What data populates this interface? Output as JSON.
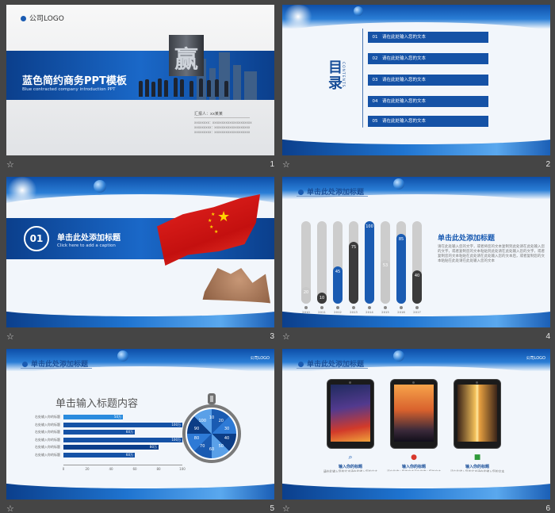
{
  "slides": [
    {
      "number": "1",
      "logo": "公司LOGO",
      "title": "蓝色简约商务PPT模板",
      "subtitle": "Blue contracted  company introduction  PPT",
      "monument_glyph": "赢",
      "presenter": "汇报人：xx某某",
      "details": [
        "xxxxxxxx：xxxxxxxxxxxxxxxxxxxxx",
        "xxxxxxxxx：xxxxxxxxxxxxxxxxxxx",
        "xxxxxxxxx：xxxxxxxxxxxxxxxxxxx"
      ]
    },
    {
      "number": "2",
      "toc_title": "目录",
      "toc_en": "CONTENTS",
      "items": [
        {
          "num": "01",
          "text": "请在此处输入您的文本"
        },
        {
          "num": "02",
          "text": "请在此处输入您的文本"
        },
        {
          "num": "03",
          "text": "请在此处输入您的文本"
        },
        {
          "num": "04",
          "text": "请在此处输入您的文本"
        },
        {
          "num": "05",
          "text": "请在此处输入您的文本"
        }
      ]
    },
    {
      "number": "3",
      "section_num": "01",
      "title": "单击此处添加标题",
      "subtitle": "Click here to add a caption"
    },
    {
      "number": "4",
      "header": "单击此处添加标题",
      "side_title": "单击此处添加标题",
      "side_body": "请在此处输入您的文字，或者将您的文本复制到此处请在此处输入您的文字，或者复制您的文本粘贴到此处请在此处输入您的文字，或者复制您的文本粘贴在此处请在此处输入您的文本后，或者复制您的文本粘贴在此处请在此处输入您的文本"
    },
    {
      "number": "5",
      "header": "单击此处添加标题",
      "heading": "单击输入标题内容",
      "corner_logo": "公司LOGO"
    },
    {
      "number": "6",
      "header": "单击此处添加标题",
      "corner_logo": "公司LOGO",
      "cards": [
        {
          "caption": "输入你的标题",
          "body": "请在此输入您的文本请在此输入您的文本请在此输入您的文本请在此输入您的文本"
        },
        {
          "caption": "输入你的标题",
          "body": "请在此输入您的文本请在此输入您的文本请在此输入您的文本请在此输入您的文本"
        },
        {
          "caption": "输入你的标题",
          "body": "请在此输入您的文本请在此输入您的文本请在此输入您的文本请在此输入您的文本"
        }
      ]
    }
  ],
  "chart_data": [
    {
      "type": "bar",
      "categories": [
        "2010",
        "2011",
        "2012",
        "2013",
        "2014",
        "2015",
        "2016",
        "2017"
      ],
      "values": [
        20,
        10,
        45,
        75,
        100,
        53,
        85,
        40
      ],
      "ylim": [
        0,
        100
      ],
      "colors": [
        "#c8c8c8",
        "#3b3b3b",
        "#1a5bb2",
        "#3b3b3b",
        "#1a5bb2",
        "#c8c8c8",
        "#1a5bb2",
        "#3b3b3b"
      ]
    },
    {
      "type": "bar",
      "orientation": "horizontal",
      "categories": [
        "右处输入你的标题",
        "右处输入你的标题",
        "右处输入你的标题",
        "右处输入你的标题",
        "右处输入你的标题",
        "右处输入你的标题"
      ],
      "values": [
        50,
        100,
        60,
        100,
        80,
        60
      ],
      "value_labels": [
        "50万",
        "100万",
        "60万",
        "100万",
        "80万",
        "60万"
      ],
      "xticks": [
        "0",
        "20",
        "40",
        "60",
        "80",
        "100"
      ],
      "xlim": [
        0,
        100
      ]
    },
    {
      "type": "pie",
      "labels": [
        "10",
        "20",
        "30",
        "40",
        "50",
        "60",
        "70",
        "80",
        "90",
        "100"
      ]
    }
  ],
  "colors": {
    "accent": "#1a5bb2",
    "dark": "#0b3f8c",
    "background": "#454545"
  }
}
